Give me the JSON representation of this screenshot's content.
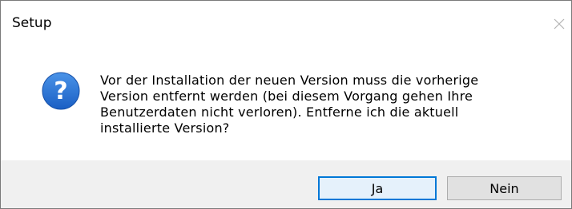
{
  "window": {
    "title": "Setup"
  },
  "dialog": {
    "icon": "question-icon",
    "message": "Vor der Installation der neuen Version muss die vorherige\nVersion entfernt werden (bei diesem Vorgang gehen Ihre\nBenutzerdaten nicht verloren). Entferne ich die aktuell\ninstallierte Version?"
  },
  "buttons": {
    "yes_label": "Ja",
    "no_label": "Nein"
  },
  "colors": {
    "icon_blue": "#1f6fd0",
    "focus_border": "#0078d7",
    "footer_bg": "#f0f0f0"
  }
}
